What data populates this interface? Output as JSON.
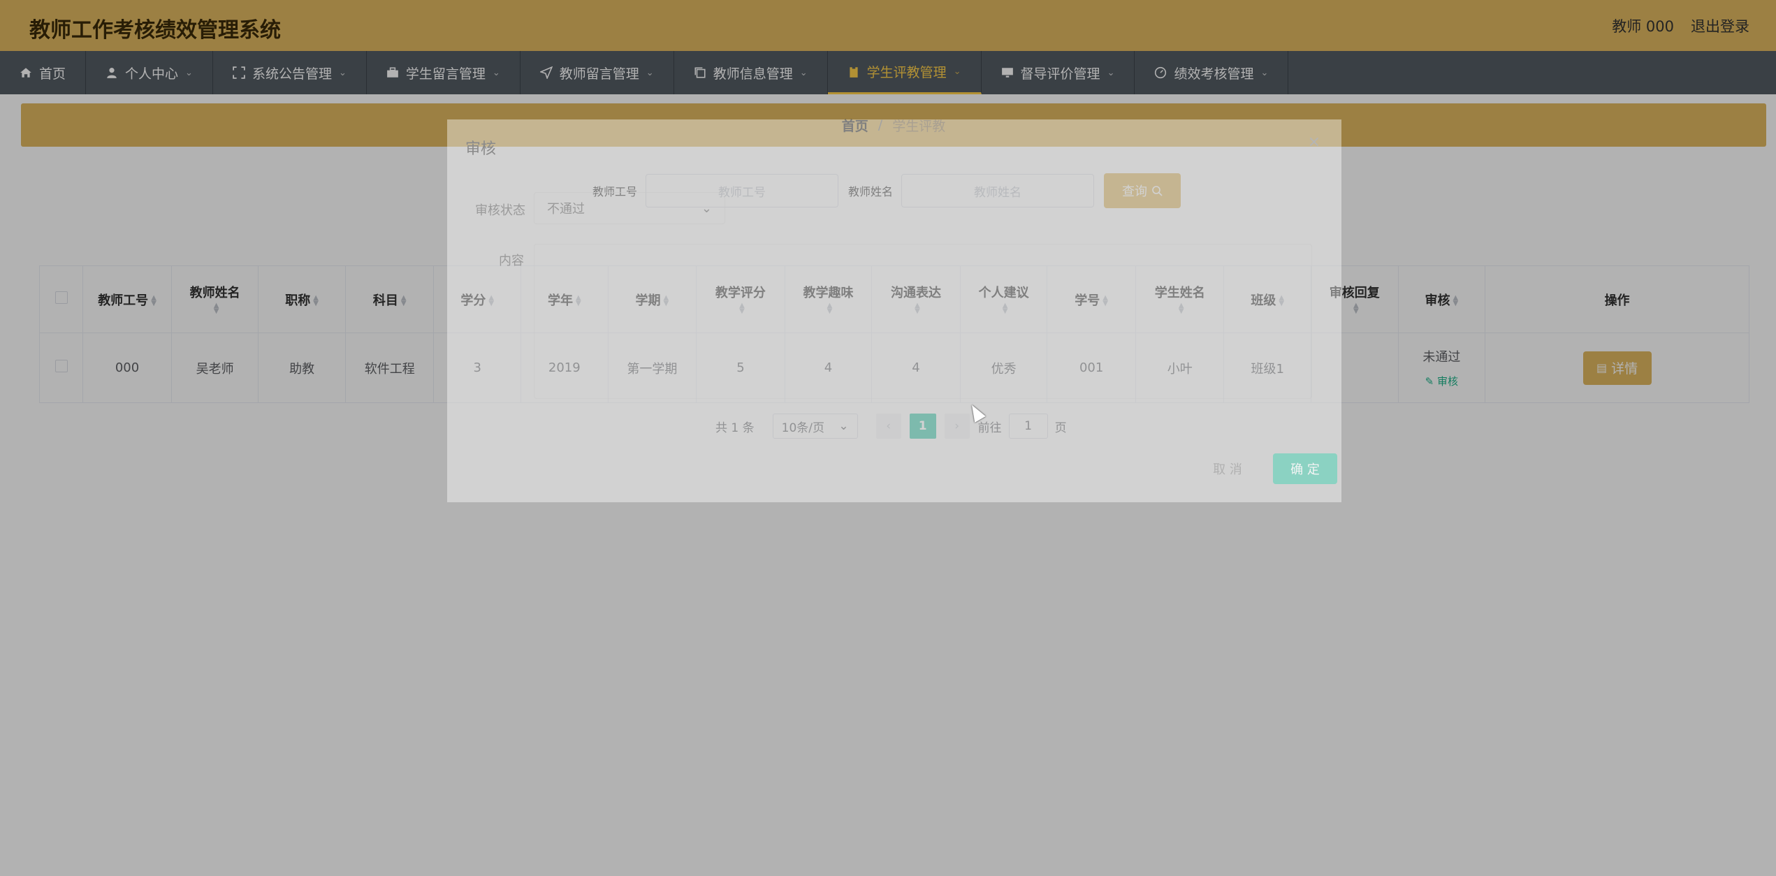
{
  "header": {
    "title": "教师工作考核绩效管理系统",
    "user": "教师 000",
    "logout": "退出登录"
  },
  "nav": [
    {
      "label": "首页",
      "icon": "home-icon",
      "has_dropdown": false
    },
    {
      "label": "个人中心",
      "icon": "user-icon",
      "has_dropdown": true
    },
    {
      "label": "系统公告管理",
      "icon": "fullscreen-icon",
      "has_dropdown": true
    },
    {
      "label": "学生留言管理",
      "icon": "briefcase-icon",
      "has_dropdown": true
    },
    {
      "label": "教师留言管理",
      "icon": "send-icon",
      "has_dropdown": true
    },
    {
      "label": "教师信息管理",
      "icon": "copy-icon",
      "has_dropdown": true
    },
    {
      "label": "学生评教管理",
      "icon": "clipboard-icon",
      "has_dropdown": true,
      "active": true
    },
    {
      "label": "督导评价管理",
      "icon": "monitor-icon",
      "has_dropdown": true
    },
    {
      "label": "绩效考核管理",
      "icon": "gauge-icon",
      "has_dropdown": true
    }
  ],
  "breadcrumb": {
    "home": "首页",
    "separator": "/",
    "current": "学生评教"
  },
  "search": {
    "teacher_id_label": "教师工号",
    "teacher_id_placeholder": "教师工号",
    "teacher_name_label": "教师姓名",
    "teacher_name_placeholder": "教师姓名",
    "query_button": "查询"
  },
  "table": {
    "columns": [
      "教师工号",
      "教师姓名",
      "职称",
      "科目",
      "学分",
      "学年",
      "学期",
      "教学评分",
      "教学趣味",
      "沟通表达",
      "个人建议",
      "学号",
      "学生姓名",
      "班级",
      "审核回复",
      "审核",
      "操作"
    ],
    "rows": [
      {
        "teacher_id": "000",
        "teacher_name": "吴老师",
        "title": "助教",
        "subject": "软件工程",
        "credit": "3",
        "year": "2019",
        "term": "第一学期",
        "teaching_score": "5",
        "interest": "4",
        "communication": "4",
        "suggestion": "优秀",
        "student_id": "001",
        "student_name": "小叶",
        "class": "班级1",
        "reply": "",
        "status": "未通过",
        "audit_link": "审核",
        "detail_button": "详情"
      }
    ]
  },
  "pagination": {
    "total": "共 1 条",
    "page_size": "10条/页",
    "current_page": "1",
    "goto_label": "前往",
    "goto_value": "1",
    "page_suffix": "页"
  },
  "dialog": {
    "title": "审核",
    "status_label": "审核状态",
    "status_value": "不通过",
    "content_label": "内容",
    "cancel": "取 消",
    "confirm": "确 定"
  },
  "colors": {
    "brand": "#e0b860",
    "nav_bg": "#545c64",
    "nav_active": "#ffd04b",
    "page_active": "#2fc5a5",
    "audit_link": "#1fb38a"
  }
}
